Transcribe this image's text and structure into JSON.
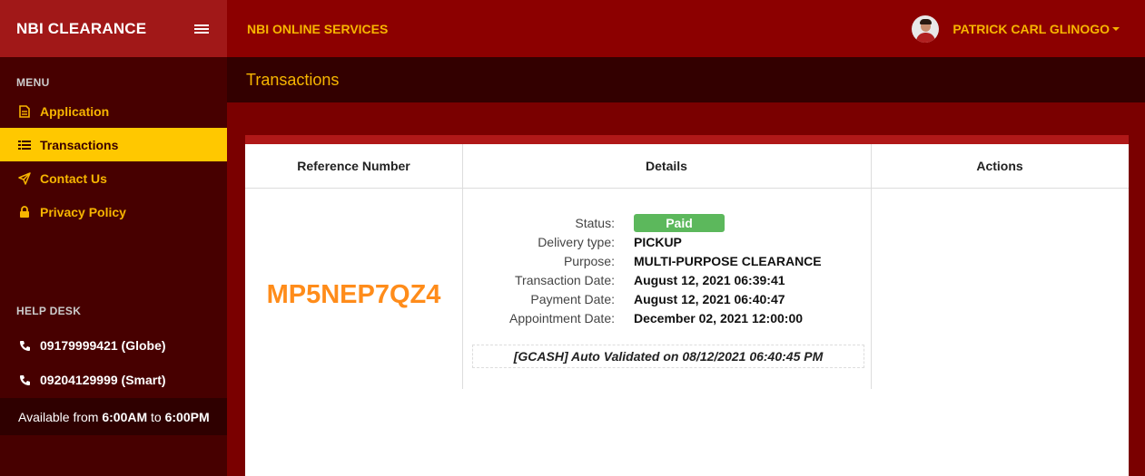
{
  "brand": {
    "title": "NBI CLEARANCE"
  },
  "topbar": {
    "title": "NBI ONLINE SERVICES",
    "user_name": "PATRICK CARL GLINOGO"
  },
  "sidebar": {
    "menu_header": "MENU",
    "items": [
      {
        "label": "Application",
        "icon": "document-icon",
        "active": false
      },
      {
        "label": "Transactions",
        "icon": "list-icon",
        "active": true
      },
      {
        "label": "Contact Us",
        "icon": "paper-plane-icon",
        "active": false
      },
      {
        "label": "Privacy Policy",
        "icon": "lock-icon",
        "active": false
      }
    ],
    "help_header": "HELP DESK",
    "help_items": [
      {
        "label": "09179999421 (Globe)",
        "icon": "phone-icon"
      },
      {
        "label": "09204129999 (Smart)",
        "icon": "phone-icon"
      }
    ],
    "availability": {
      "prefix": "Available from ",
      "from": "6:00AM",
      "mid": " to ",
      "to": "6:00PM"
    }
  },
  "page": {
    "title": "Transactions"
  },
  "table": {
    "headers": [
      "Reference Number",
      "Details",
      "Actions"
    ],
    "row": {
      "reference": "MP5NEP7QZ4",
      "details": {
        "status_label": "Status:",
        "status_value": "Paid",
        "delivery_label": "Delivery type:",
        "delivery_value": "PICKUP",
        "purpose_label": "Purpose:",
        "purpose_value": "MULTI-PURPOSE CLEARANCE",
        "transaction_label": "Transaction Date:",
        "transaction_value": "August 12, 2021 06:39:41",
        "payment_label": "Payment Date:",
        "payment_value": "August 12, 2021 06:40:47",
        "appointment_label": "Appointment Date:",
        "appointment_value": "December 02, 2021 12:00:00"
      },
      "note": "[GCASH] Auto Validated on 08/12/2021 06:40:45 PM"
    }
  },
  "colors": {
    "accent": "#f7b500",
    "active_bg": "#ffc800",
    "status_paid": "#5cb85c",
    "reference": "#ff8c1a"
  }
}
